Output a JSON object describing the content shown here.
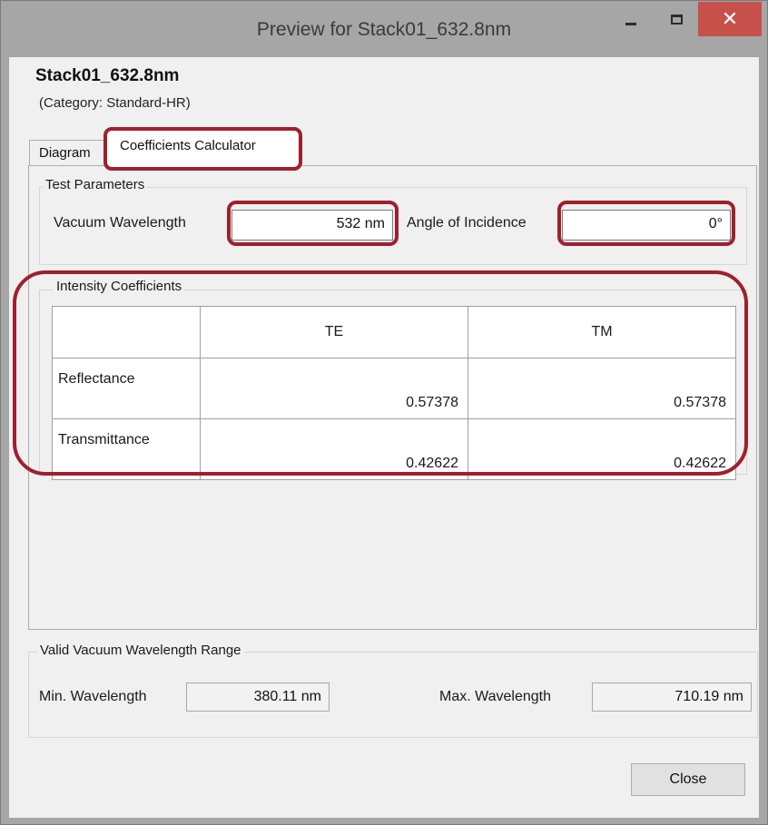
{
  "window": {
    "title": "Preview for Stack01_632.8nm",
    "close_glyph": "✕",
    "highlight_color": "#a01f2d",
    "close_button_color": "#c7504b"
  },
  "header": {
    "name": "Stack01_632.8nm",
    "category": "(Category: Standard-HR)"
  },
  "tabs": [
    {
      "label": "Diagram",
      "selected": false
    },
    {
      "label": "Coefficients Calculator",
      "selected": true
    }
  ],
  "test_parameters": {
    "group_label": "Test Parameters",
    "wavelength_label": "Vacuum Wavelength",
    "wavelength_value": "532 nm",
    "angle_label": "Angle of Incidence",
    "angle_value": "0°"
  },
  "intensity": {
    "group_label": "Intensity Coefficients",
    "columns": [
      "",
      "TE",
      "TM"
    ],
    "rows": [
      {
        "label": "Reflectance",
        "te": "0.57378",
        "tm": "0.57378"
      },
      {
        "label": "Transmittance",
        "te": "0.42622",
        "tm": "0.42622"
      }
    ]
  },
  "valid_range": {
    "group_label": "Valid Vacuum Wavelength Range",
    "min_label": "Min. Wavelength",
    "min_value": "380.11 nm",
    "max_label": "Max. Wavelength",
    "max_value": "710.19 nm"
  },
  "footer": {
    "close_label": "Close"
  }
}
